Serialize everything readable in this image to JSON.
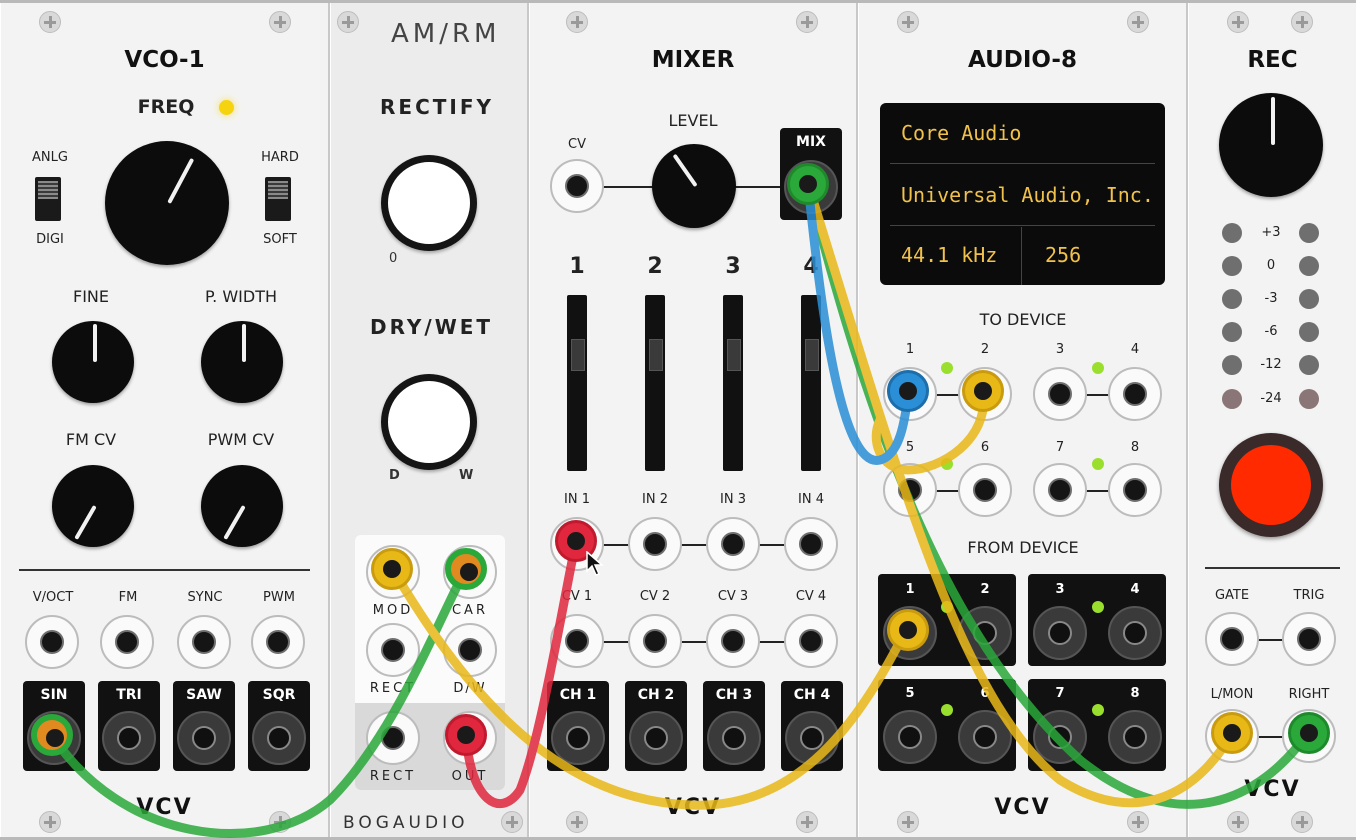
{
  "vco": {
    "title": "VCO-1",
    "freq": "FREQ",
    "anlg": "ANLG",
    "digi": "DIGI",
    "hard": "HARD",
    "soft": "SOFT",
    "fine": "FINE",
    "pwidth": "P. WIDTH",
    "fmcv": "FM CV",
    "pwmcv": "PWM CV",
    "inputs": [
      "V/OCT",
      "FM",
      "SYNC",
      "PWM"
    ],
    "outputs": [
      "SIN",
      "TRI",
      "SAW",
      "SQR"
    ],
    "brand": "VCV"
  },
  "amrm": {
    "title": "AM/RM",
    "rectify": "RECTIFY",
    "drywet": "DRY/WET",
    "zero": "0",
    "d": "D",
    "w": "W",
    "mod": "MOD",
    "car": "CAR",
    "rect": "RECT",
    "dw": "D/W",
    "rect_out": "RECT",
    "out": "OUT",
    "brand": "BOGAUDIO"
  },
  "mixer": {
    "title": "MIXER",
    "level": "LEVEL",
    "cv": "CV",
    "mix": "MIX",
    "channels": [
      "1",
      "2",
      "3",
      "4"
    ],
    "in_labels": [
      "IN 1",
      "IN 2",
      "IN 3",
      "IN 4"
    ],
    "cv_labels": [
      "CV 1",
      "CV 2",
      "CV 3",
      "CV 4"
    ],
    "ch_labels": [
      "CH 1",
      "CH 2",
      "CH 3",
      "CH 4"
    ],
    "brand": "VCV"
  },
  "audio": {
    "title": "AUDIO-8",
    "driver": "Core Audio",
    "device": "Universal Audio, Inc.",
    "sample_rate": "44.1 kHz",
    "block_size": "256",
    "to_device": "TO DEVICE",
    "from_device": "FROM DEVICE",
    "ports": [
      "1",
      "2",
      "3",
      "4",
      "5",
      "6",
      "7",
      "8"
    ],
    "brand": "VCV"
  },
  "rec": {
    "title": "REC",
    "meter_labels": [
      "+3",
      "0",
      "-3",
      "-6",
      "-12",
      "-24"
    ],
    "gate": "GATE",
    "trig": "TRIG",
    "lmon": "L/MON",
    "right": "RIGHT",
    "brand": "VCV"
  },
  "colors": {
    "green": "#2aa83a",
    "yellow": "#e8b817",
    "red": "#e0273d",
    "blue": "#2a8fd6",
    "led_yellow": "#f5d30f",
    "record": "#ff2a00"
  }
}
